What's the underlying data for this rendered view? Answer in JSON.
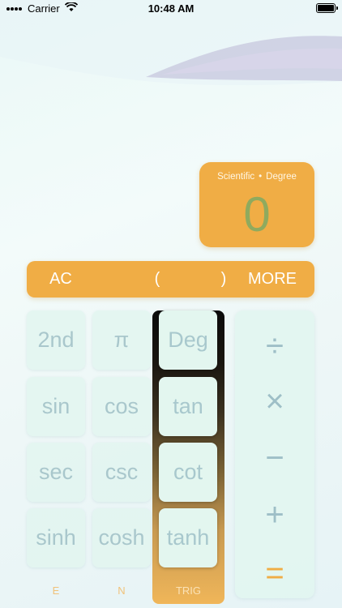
{
  "status_bar": {
    "carrier": "Carrier",
    "time": "10:48 AM"
  },
  "display": {
    "mode": "Scientific",
    "angle_unit": "Degree",
    "separator": "•",
    "value": "0"
  },
  "control_bar": {
    "ac": "AC",
    "open_paren": "(",
    "close_paren": ")",
    "more": "MORE"
  },
  "keys": {
    "second": "2nd",
    "pi": "π",
    "deg": "Deg",
    "sin": "sin",
    "cos": "cos",
    "tan": "tan",
    "sec": "sec",
    "csc": "csc",
    "cot": "cot",
    "sinh": "sinh",
    "cosh": "cosh",
    "tanh": "tanh"
  },
  "operators": {
    "divide": "÷",
    "multiply": "×",
    "minus": "−",
    "plus": "+",
    "equals": "="
  },
  "tabs": {
    "e": "E",
    "n": "N",
    "trig": "TRIG",
    "active": "TRIG"
  },
  "colors": {
    "accent": "#f0ad45",
    "display_digits": "#8faa5e",
    "key_text": "#a9c7cc",
    "operator": "#9ebfc7"
  }
}
